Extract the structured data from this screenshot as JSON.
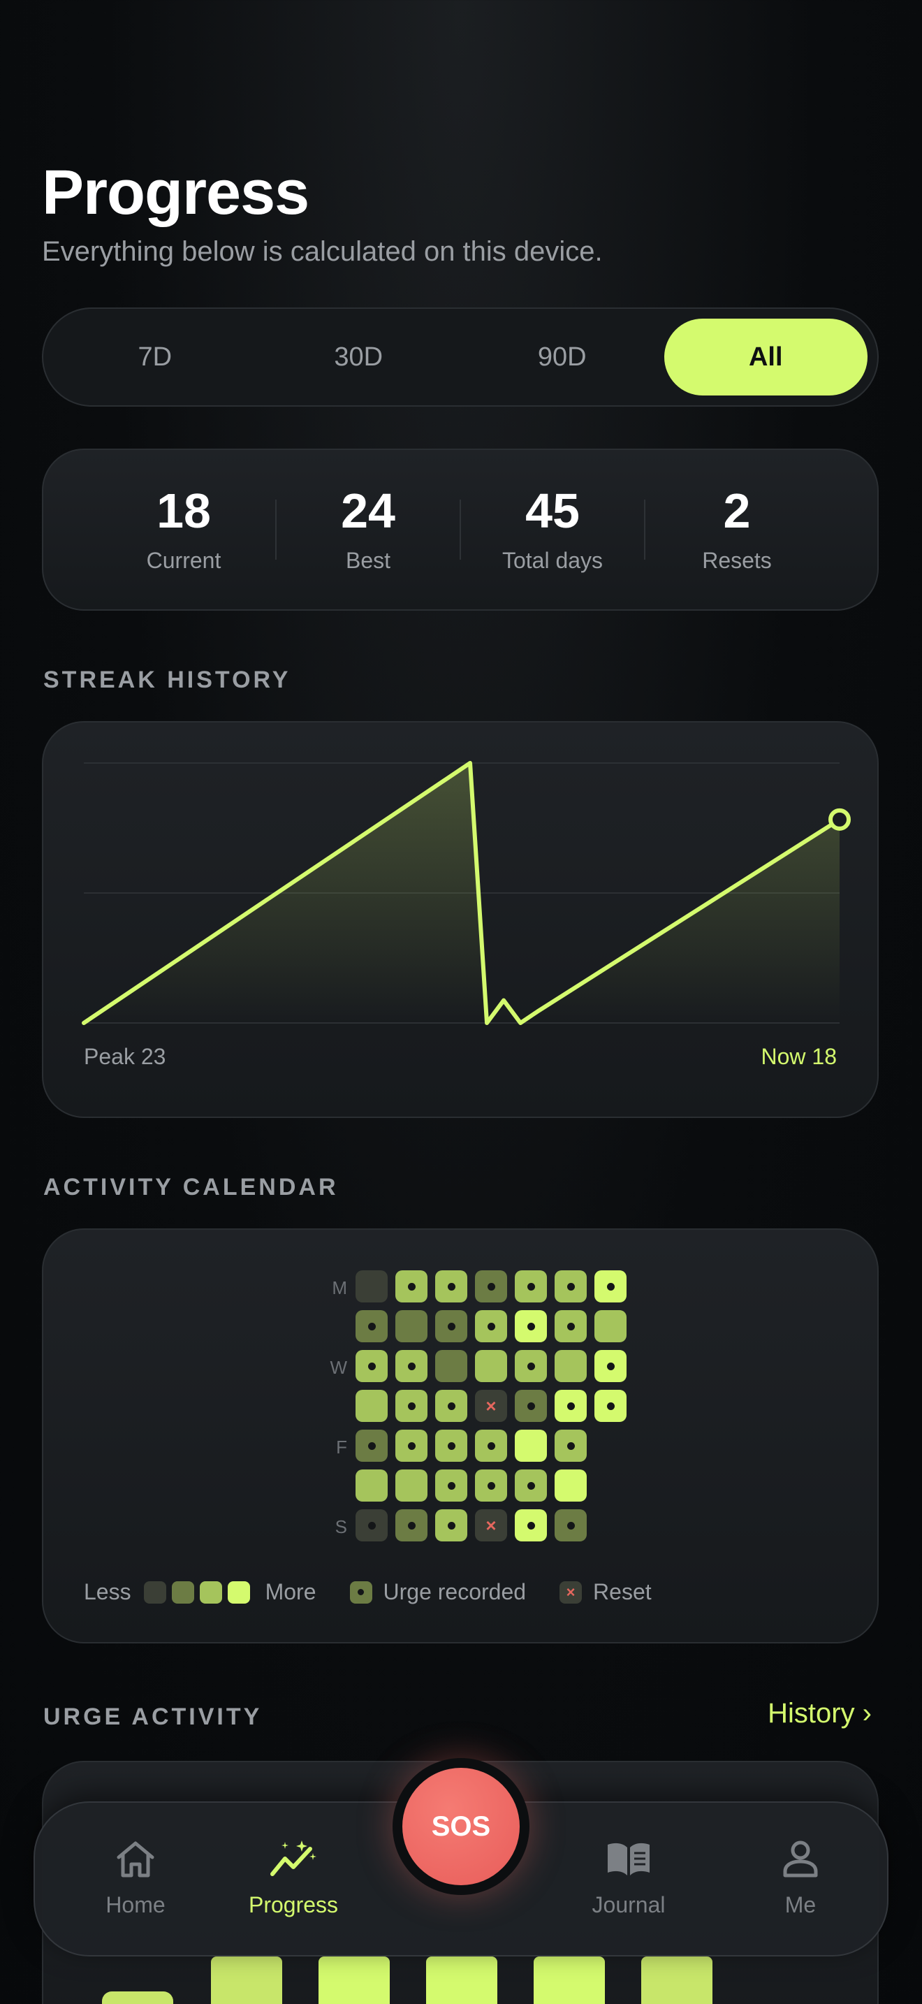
{
  "header": {
    "title": "Progress",
    "subtitle": "Everything below is calculated on this device."
  },
  "range_tabs": [
    {
      "label": "7D",
      "active": false
    },
    {
      "label": "30D",
      "active": false
    },
    {
      "label": "90D",
      "active": false
    },
    {
      "label": "All",
      "active": true
    }
  ],
  "stats": [
    {
      "value": "18",
      "label": "Current"
    },
    {
      "value": "24",
      "label": "Best"
    },
    {
      "value": "45",
      "label": "Total days"
    },
    {
      "value": "2",
      "label": "Resets"
    }
  ],
  "streak_history": {
    "section_label": "STREAK HISTORY",
    "peak_label": "Peak 23",
    "now_label": "Now 18"
  },
  "chart_data": {
    "type": "area",
    "title": "",
    "x": [
      0,
      23,
      24,
      25,
      26,
      27,
      45
    ],
    "y": [
      0,
      23,
      0,
      2,
      0,
      1,
      18
    ],
    "ylim": [
      0,
      23
    ],
    "grid": true,
    "color": "#d4fa6e"
  },
  "activity_calendar": {
    "section_label": "ACTIVITY CALENDAR",
    "day_labels": [
      "M",
      "",
      "W",
      "",
      "F",
      "",
      "S"
    ],
    "legend": {
      "less": "Less",
      "more": "More",
      "urge": "Urge recorded",
      "reset": "Reset"
    },
    "level_colors": [
      "#3b3f36",
      "#6c7c44",
      "#a5c45c",
      "#d4fa6e"
    ],
    "rows": [
      [
        {
          "l": 0,
          "m": ""
        },
        {
          "l": 2,
          "m": "dot"
        },
        {
          "l": 2,
          "m": "dot"
        },
        {
          "l": 1,
          "m": "dot"
        },
        {
          "l": 2,
          "m": "dot"
        },
        {
          "l": 2,
          "m": "dot"
        },
        {
          "l": 3,
          "m": "dot"
        }
      ],
      [
        {
          "l": 1,
          "m": "dot"
        },
        {
          "l": 1,
          "m": ""
        },
        {
          "l": 1,
          "m": "dot"
        },
        {
          "l": 2,
          "m": "dot"
        },
        {
          "l": 3,
          "m": "dot"
        },
        {
          "l": 2,
          "m": "dot"
        },
        {
          "l": 2,
          "m": ""
        }
      ],
      [
        {
          "l": 2,
          "m": "dot"
        },
        {
          "l": 2,
          "m": "dot"
        },
        {
          "l": 1,
          "m": ""
        },
        {
          "l": 2,
          "m": ""
        },
        {
          "l": 2,
          "m": "dot"
        },
        {
          "l": 2,
          "m": ""
        },
        {
          "l": 3,
          "m": "dot"
        }
      ],
      [
        {
          "l": 2,
          "m": ""
        },
        {
          "l": 2,
          "m": "dot"
        },
        {
          "l": 2,
          "m": "dot"
        },
        {
          "l": 0,
          "m": "x"
        },
        {
          "l": 1,
          "m": "dot"
        },
        {
          "l": 3,
          "m": "dot"
        },
        {
          "l": 3,
          "m": "dot"
        }
      ],
      [
        {
          "l": 1,
          "m": "dot"
        },
        {
          "l": 2,
          "m": "dot"
        },
        {
          "l": 2,
          "m": "dot"
        },
        {
          "l": 2,
          "m": "dot"
        },
        {
          "l": 3,
          "m": ""
        },
        {
          "l": 2,
          "m": "dot"
        }
      ],
      [
        {
          "l": 2,
          "m": ""
        },
        {
          "l": 2,
          "m": ""
        },
        {
          "l": 2,
          "m": "dot"
        },
        {
          "l": 2,
          "m": "dot"
        },
        {
          "l": 2,
          "m": "dot"
        },
        {
          "l": 3,
          "m": ""
        }
      ],
      [
        {
          "l": 0,
          "m": "dot"
        },
        {
          "l": 1,
          "m": "dot"
        },
        {
          "l": 2,
          "m": "dot"
        },
        {
          "l": 0,
          "m": "x"
        },
        {
          "l": 3,
          "m": "dot"
        },
        {
          "l": 1,
          "m": "dot"
        }
      ]
    ]
  },
  "urge_activity": {
    "section_label": "URGE ACTIVITY",
    "history_link": "History ›"
  },
  "nav": {
    "items": [
      {
        "label": "Home",
        "icon": "home-icon",
        "active": false
      },
      {
        "label": "Progress",
        "icon": "progress-icon",
        "active": true
      },
      {
        "label": "Journal",
        "icon": "journal-icon",
        "active": false
      },
      {
        "label": "Me",
        "icon": "profile-icon",
        "active": false
      }
    ],
    "sos_label": "SOS"
  }
}
